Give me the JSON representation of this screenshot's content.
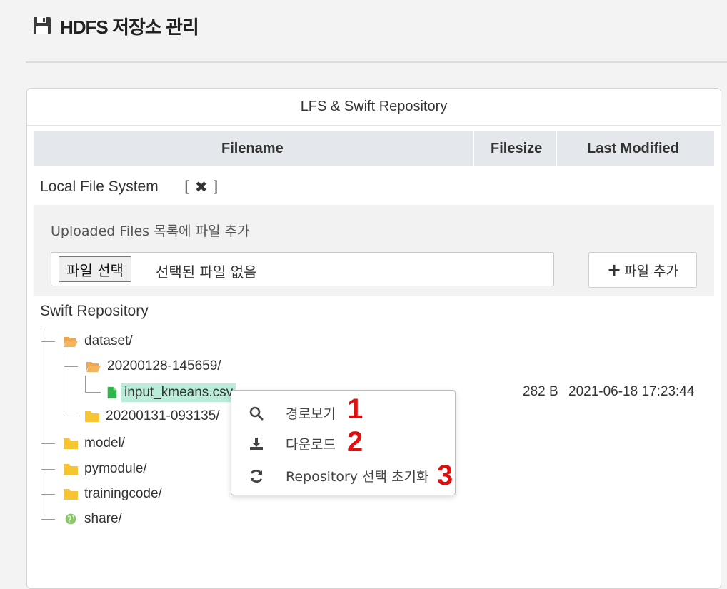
{
  "page": {
    "title": "HDFS 저장소 관리"
  },
  "panel": {
    "heading": "LFS & Swift Repository"
  },
  "table": {
    "columns": [
      "Filename",
      "Filesize",
      "Last Modified"
    ]
  },
  "local_fs": {
    "label": "Local File System",
    "close_label": "[ ✖ ]",
    "upload_caption": "Uploaded Files 목록에 파일 추가",
    "choose_button": "파일 선택",
    "no_file_text": "선택된 파일 없음",
    "add_button": "파일 추가"
  },
  "swift": {
    "label": "Swift Repository",
    "tree": {
      "dataset": "dataset/",
      "sub1": "20200128-145659/",
      "file": "input_kmeans.csv",
      "sub2": "20200131-093135/",
      "model": "model/",
      "pymodule": "pymodule/",
      "trainingcode": "trainingcode/",
      "share": "share/"
    },
    "selected_file": {
      "size": "282 B",
      "modified": "2021-06-18 17:23:44"
    }
  },
  "context_menu": {
    "items": [
      {
        "label": "경로보기",
        "icon": "search-icon"
      },
      {
        "label": "다운로드",
        "icon": "download-icon"
      },
      {
        "label": "Repository 선택 초기화",
        "icon": "refresh-icon"
      }
    ]
  },
  "annotations": [
    "1",
    "2",
    "3"
  ],
  "colors": {
    "folder": "#f7c531",
    "folder_open": "#f0a64a",
    "file": "#2fb34a",
    "share": "#8ac56a",
    "selection": "#b9ecd9",
    "annotation": "#e01010"
  }
}
